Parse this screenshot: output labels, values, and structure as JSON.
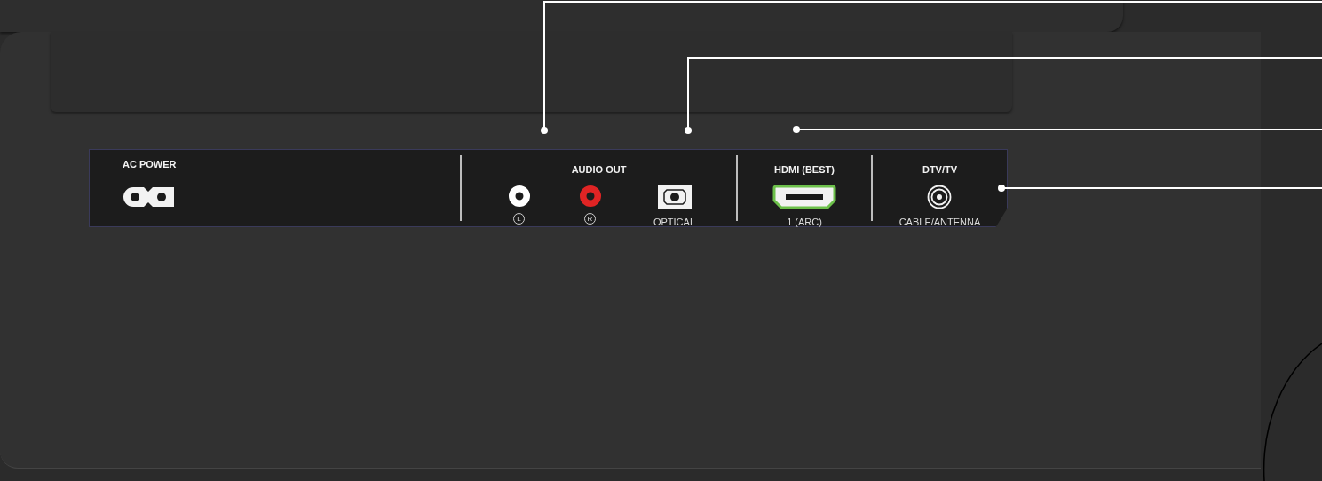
{
  "panel": {
    "sections": [
      {
        "kind": "power",
        "label": "AC POWER",
        "ports": [
          {
            "kind": "power"
          }
        ]
      },
      {
        "kind": "audio",
        "label": "AUDIO OUT",
        "ports": [
          {
            "kind": "rca",
            "color": "#ffffff",
            "caption": "L"
          },
          {
            "kind": "rca",
            "color": "#e02424",
            "caption": "R"
          },
          {
            "kind": "optical",
            "caption": "OPTICAL"
          }
        ]
      },
      {
        "kind": "hdmi",
        "label": "HDMI (BEST)",
        "ports": [
          {
            "kind": "hdmi",
            "caption": "1 (ARC)"
          }
        ]
      },
      {
        "kind": "coax",
        "label": "DTV/TV",
        "ports": [
          {
            "kind": "coax",
            "caption": "CABLE/ANTENNA"
          }
        ]
      }
    ]
  }
}
